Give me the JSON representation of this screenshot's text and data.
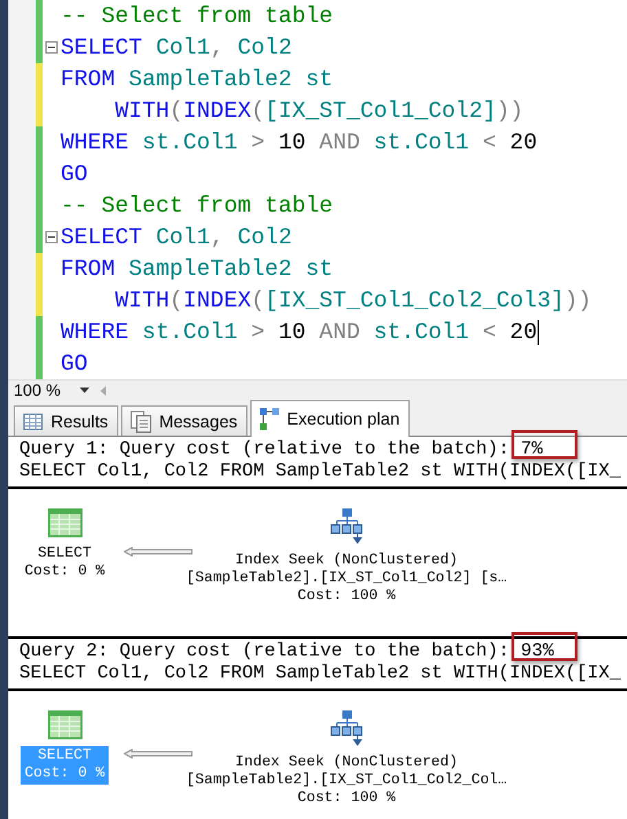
{
  "editor": {
    "lines": [
      {
        "modified": false,
        "fold": false,
        "cursor": false,
        "tokens": [
          {
            "kind": "comment",
            "text": "-- Select from table"
          }
        ]
      },
      {
        "modified": false,
        "fold": true,
        "cursor": false,
        "tokens": [
          {
            "kind": "keyword",
            "text": "SELECT"
          },
          {
            "kind": "ident",
            "text": " Col1"
          },
          {
            "kind": "op",
            "text": ","
          },
          {
            "kind": "ident",
            "text": " Col2"
          }
        ]
      },
      {
        "modified": true,
        "fold": false,
        "cursor": false,
        "tokens": [
          {
            "kind": "keyword",
            "text": "FROM"
          },
          {
            "kind": "ident",
            "text": " SampleTable2 st"
          }
        ]
      },
      {
        "modified": true,
        "fold": false,
        "cursor": false,
        "tokens": [
          {
            "kind": "keyword",
            "text": "    WITH"
          },
          {
            "kind": "op",
            "text": "("
          },
          {
            "kind": "keyword",
            "text": "INDEX"
          },
          {
            "kind": "op",
            "text": "("
          },
          {
            "kind": "ident",
            "text": "[IX_ST_Col1_Col2]"
          },
          {
            "kind": "op",
            "text": "))"
          }
        ]
      },
      {
        "modified": false,
        "fold": false,
        "cursor": false,
        "tokens": [
          {
            "kind": "keyword",
            "text": "WHERE"
          },
          {
            "kind": "ident",
            "text": " st.Col1"
          },
          {
            "kind": "op",
            "text": " >"
          },
          {
            "kind": "number",
            "text": " 10"
          },
          {
            "kind": "op",
            "text": " AND"
          },
          {
            "kind": "ident",
            "text": " st.Col1"
          },
          {
            "kind": "op",
            "text": " <"
          },
          {
            "kind": "number",
            "text": " 20"
          }
        ]
      },
      {
        "modified": false,
        "fold": false,
        "cursor": false,
        "tokens": [
          {
            "kind": "keyword",
            "text": "GO"
          }
        ]
      },
      {
        "modified": false,
        "fold": false,
        "cursor": false,
        "tokens": [
          {
            "kind": "comment",
            "text": "-- Select from table"
          }
        ]
      },
      {
        "modified": false,
        "fold": true,
        "cursor": false,
        "tokens": [
          {
            "kind": "keyword",
            "text": "SELECT"
          },
          {
            "kind": "ident",
            "text": " Col1"
          },
          {
            "kind": "op",
            "text": ","
          },
          {
            "kind": "ident",
            "text": " Col2"
          }
        ]
      },
      {
        "modified": true,
        "fold": false,
        "cursor": false,
        "tokens": [
          {
            "kind": "keyword",
            "text": "FROM"
          },
          {
            "kind": "ident",
            "text": " SampleTable2 st"
          }
        ]
      },
      {
        "modified": true,
        "fold": false,
        "cursor": false,
        "tokens": [
          {
            "kind": "keyword",
            "text": "    WITH"
          },
          {
            "kind": "op",
            "text": "("
          },
          {
            "kind": "keyword",
            "text": "INDEX"
          },
          {
            "kind": "op",
            "text": "("
          },
          {
            "kind": "ident",
            "text": "[IX_ST_Col1_Col2_Col3]"
          },
          {
            "kind": "op",
            "text": "))"
          }
        ]
      },
      {
        "modified": false,
        "fold": false,
        "cursor": true,
        "tokens": [
          {
            "kind": "keyword",
            "text": "WHERE"
          },
          {
            "kind": "ident",
            "text": " st.Col1"
          },
          {
            "kind": "op",
            "text": " >"
          },
          {
            "kind": "number",
            "text": " 10"
          },
          {
            "kind": "op",
            "text": " AND"
          },
          {
            "kind": "ident",
            "text": " st.Col1"
          },
          {
            "kind": "op",
            "text": " <"
          },
          {
            "kind": "number",
            "text": " 20"
          }
        ]
      },
      {
        "modified": false,
        "fold": false,
        "cursor": false,
        "tokens": [
          {
            "kind": "keyword",
            "text": "GO"
          }
        ]
      }
    ]
  },
  "zoom": {
    "value": "100 %"
  },
  "tabs": [
    {
      "kind": "results",
      "label": "Results",
      "selected": false
    },
    {
      "kind": "messages",
      "label": "Messages",
      "selected": false
    },
    {
      "kind": "plan",
      "label": "Execution plan",
      "selected": true
    }
  ],
  "queries": [
    {
      "header": "Query 1: Query cost (relative to the batch):",
      "cost": "7%",
      "highlighted": true,
      "sql": "SELECT Col1, Col2 FROM SampleTable2 st WITH(INDEX([IX_",
      "select": {
        "name": "SELECT",
        "cost": "Cost: 0 %",
        "selected": false
      },
      "seek": {
        "name": "Index Seek (NonClustered)",
        "object": "[SampleTable2].[IX_ST_Col1_Col2] [s…",
        "cost": "Cost: 100 %"
      }
    },
    {
      "header": "Query 2: Query cost (relative to the batch):",
      "cost": "93%",
      "highlighted": true,
      "sql": "SELECT Col1, Col2 FROM SampleTable2 st WITH(INDEX([IX_",
      "select": {
        "name": "SELECT",
        "cost": "Cost: 0 %",
        "selected": true
      },
      "seek": {
        "name": "Index Seek (NonClustered)",
        "object": "[SampleTable2].[IX_ST_Col1_Col2_Col…",
        "cost": "Cost: 100 %"
      }
    }
  ]
}
